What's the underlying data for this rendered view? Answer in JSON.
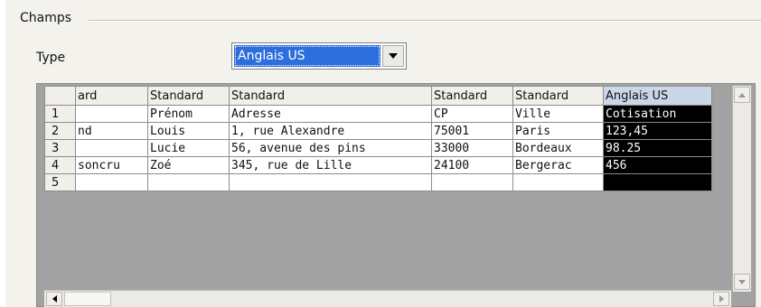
{
  "group": {
    "title": "Champs"
  },
  "type_field": {
    "label": "Type",
    "selected": "Anglais US"
  },
  "grid": {
    "columns": [
      "ard",
      "Standard",
      "Standard",
      "Standard",
      "Standard",
      "Anglais US"
    ],
    "rows": [
      {
        "num": "1",
        "cells": [
          "",
          "Prénom",
          "Adresse",
          "CP",
          "Ville",
          "Cotisation"
        ]
      },
      {
        "num": "2",
        "cells": [
          "nd",
          "Louis",
          "1, rue Alexandre",
          "75001",
          "Paris",
          "123,45"
        ]
      },
      {
        "num": "3",
        "cells": [
          "",
          "Lucie",
          "56, avenue des pins",
          "33000",
          "Bordeaux",
          "98.25"
        ]
      },
      {
        "num": "4",
        "cells": [
          "soncru",
          "Zoé",
          "345, rue de Lille",
          "24100",
          "Bergerac",
          "456"
        ]
      },
      {
        "num": "5",
        "cells": [
          "",
          "",
          "",
          "",
          "",
          ""
        ]
      }
    ]
  },
  "icons": {
    "dropdown": "chevron-down-icon",
    "scroll_up": "scroll-up-icon",
    "scroll_down": "scroll-down-icon",
    "scroll_left": "scroll-left-icon",
    "scroll_right": "scroll-right-icon"
  },
  "colors": {
    "selection": "#2c6edb",
    "selected_column": "#000000",
    "grid_empty_area": "#a2a2a2",
    "dialog_bg": "#f4f2ec"
  }
}
